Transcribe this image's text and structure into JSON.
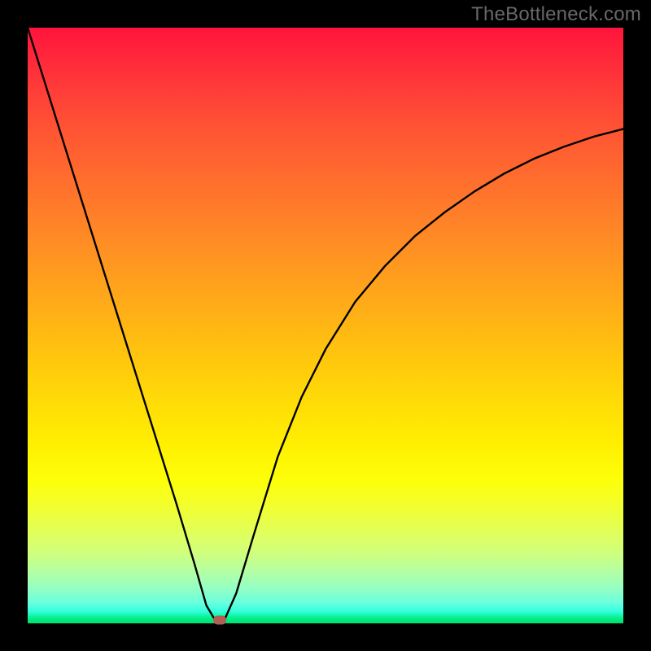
{
  "watermark": "TheBottleneck.com",
  "colors": {
    "frame": "#000000",
    "curve": "#000000",
    "marker": "#b15f54",
    "gradient_top": "#ff143c",
    "gradient_bottom": "#00e070"
  },
  "chart_data": {
    "type": "line",
    "title": "",
    "xlabel": "",
    "ylabel": "",
    "xlim": [
      0,
      100
    ],
    "ylim": [
      0,
      100
    ],
    "grid": false,
    "series": [
      {
        "name": "bottleneck-curve",
        "x": [
          0,
          5,
          10,
          15,
          20,
          25,
          28,
          30,
          31.5,
          33,
          35,
          38,
          42,
          46,
          50,
          55,
          60,
          65,
          70,
          75,
          80,
          85,
          90,
          95,
          100
        ],
        "y": [
          100,
          84,
          68,
          52,
          36,
          20,
          10,
          3,
          0.5,
          0.5,
          5,
          15,
          28,
          38,
          46,
          54,
          60,
          65,
          69,
          72.5,
          75.5,
          78,
          80,
          81.7,
          83
        ]
      }
    ],
    "marker": {
      "x": 32.2,
      "y": 0.6
    },
    "annotations": []
  }
}
